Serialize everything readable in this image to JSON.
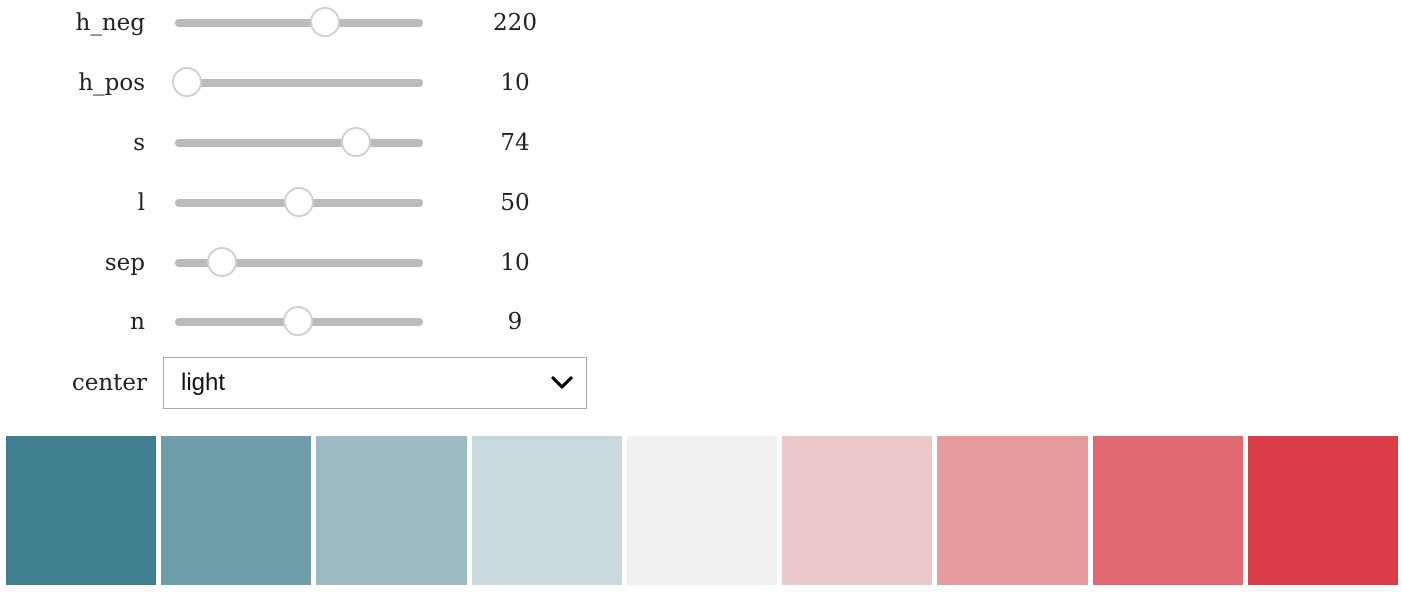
{
  "controls": {
    "sliders": [
      {
        "key": "h_neg",
        "label": "h_neg",
        "value": "220",
        "min": 0,
        "max": 359,
        "level": 0.613
      },
      {
        "key": "h_pos",
        "label": "h_pos",
        "value": "10",
        "min": 0,
        "max": 359,
        "level": 0.028
      },
      {
        "key": "s",
        "label": "s",
        "value": "74",
        "min": 0,
        "max": 99,
        "level": 0.747
      },
      {
        "key": "l",
        "label": "l",
        "value": "50",
        "min": 0,
        "max": 99,
        "level": 0.505
      },
      {
        "key": "sep",
        "label": "sep",
        "value": "10",
        "min": 1,
        "max": 50,
        "level": 0.18
      },
      {
        "key": "n",
        "label": "n",
        "value": "9",
        "min": 2,
        "max": 16,
        "level": 0.5
      }
    ],
    "center": {
      "label": "center",
      "selected": "light"
    }
  },
  "palette": {
    "colors": [
      "#3f7f8f",
      "#6e9eaa",
      "#9bbac4",
      "#c8d8dd",
      "#f1f1f1",
      "#ecc8cb",
      "#e69a9e",
      "#e06870",
      "#da3c48"
    ]
  }
}
